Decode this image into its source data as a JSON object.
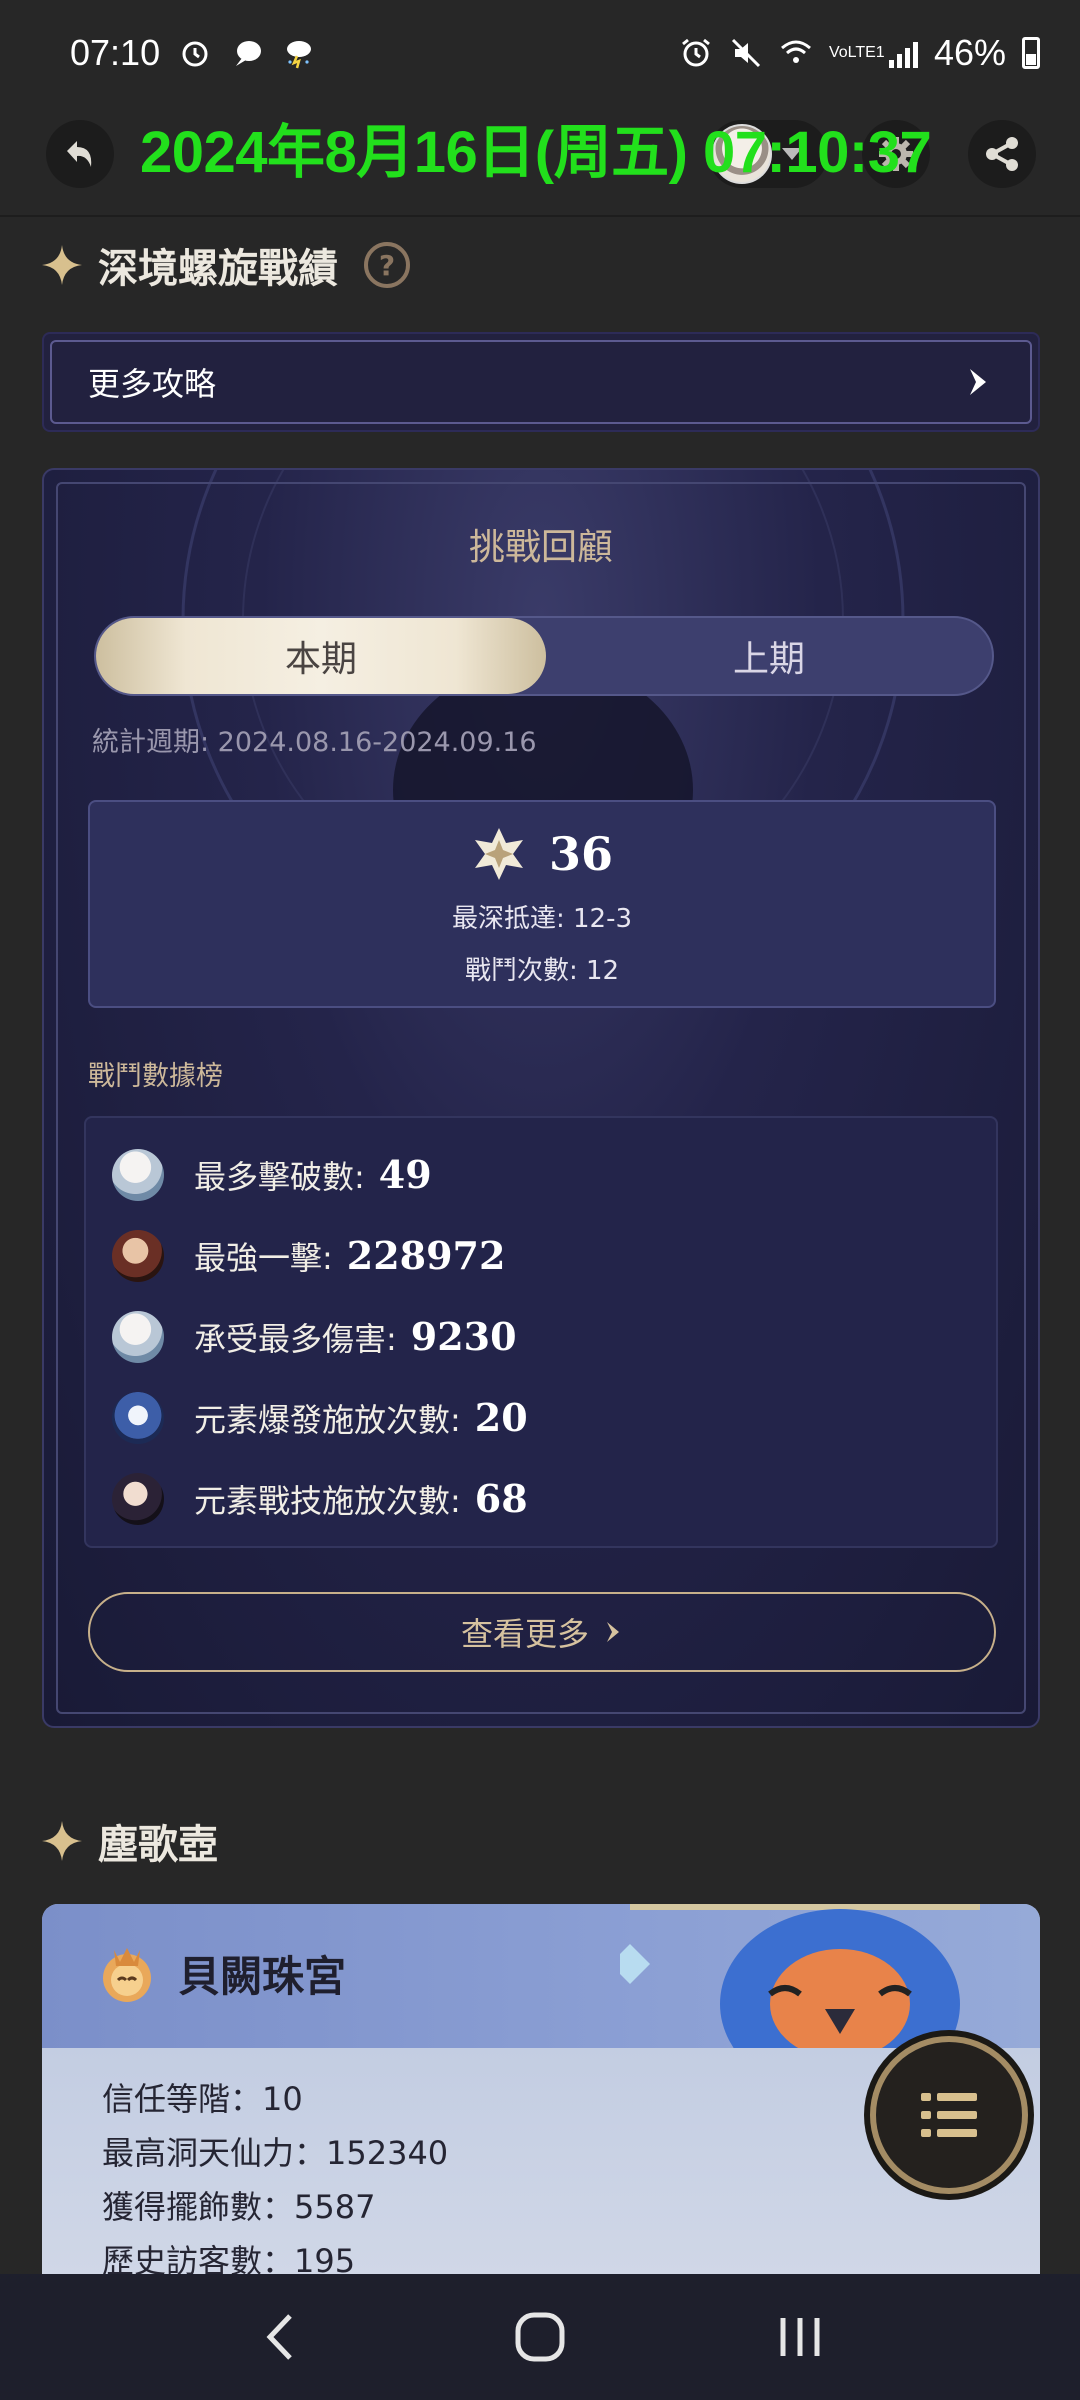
{
  "status_bar": {
    "time": "07:10",
    "battery": "46%",
    "network": "VoLTE1"
  },
  "overlay_timestamp": "2024年8月16日(周五) 07:10:37",
  "abyss": {
    "section_title": "深境螺旋戰績",
    "more_guides": "更多攻略",
    "card_title": "挑戰回顧",
    "tab_current": "本期",
    "tab_previous": "上期",
    "period": "統計週期: 2024.08.16-2024.09.16",
    "stars": "36",
    "deepest": "最深抵達: 12-3",
    "battles": "戰鬥次數: 12",
    "ranking_title": "戰鬥數據榜",
    "ranking": [
      {
        "label": "最多擊破數:",
        "value": "49",
        "avatar": "white-hair-character"
      },
      {
        "label": "最強一擊:",
        "value": "228972",
        "avatar": "brown-hair-character"
      },
      {
        "label": "承受最多傷害:",
        "value": "9230",
        "avatar": "white-hair-character"
      },
      {
        "label": "元素爆發施放次數:",
        "value": "20",
        "avatar": "blue-dragon-character"
      },
      {
        "label": "元素戰技施放次數:",
        "value": "68",
        "avatar": "dark-hair-character"
      }
    ],
    "see_more": "查看更多"
  },
  "pot": {
    "section_title": "塵歌壺",
    "realm_name": "貝闕珠宮",
    "trust_rank": "信任等階：10",
    "adeptal_energy": "最高洞天仙力：152340",
    "furnishings": "獲得擺飾數：5587",
    "visitors": "歷史訪客數：195"
  },
  "colors": {
    "overlay": "#22e01c",
    "gold": "#cdb89a",
    "card_bg": "#22234a"
  }
}
